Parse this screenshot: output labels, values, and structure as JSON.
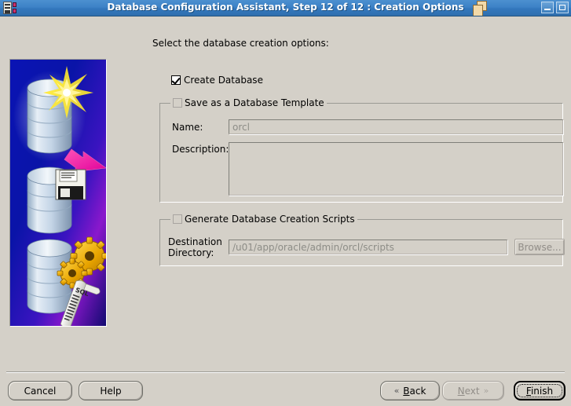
{
  "window": {
    "title": "Database Configuration Assistant, Step 12 of 12 : Creation Options",
    "icon_name": "dbca-app-icon",
    "overlay_icon_name": "copy-windows-icon",
    "minimize_label": "Minimize",
    "maximize_label": "Maximize"
  },
  "page": {
    "instruction": "Select the database creation options:"
  },
  "create_database": {
    "label": "Create Database",
    "checked": true
  },
  "template_group": {
    "title": "Save as a Database Template",
    "checked": false,
    "name_label": "Name:",
    "name_value": "orcl",
    "description_label": "Description:",
    "description_value": ""
  },
  "scripts_group": {
    "title": "Generate Database Creation Scripts",
    "checked": false,
    "destination_label_line1": "Destination",
    "destination_label_line2": "Directory:",
    "destination_value": "/u01/app/oracle/admin/orcl/scripts",
    "browse_label": "Browse...",
    "browse_enabled": false
  },
  "footer": {
    "cancel_label": "Cancel",
    "help_label": "Help",
    "back_label_pre": "",
    "back_label_mn": "B",
    "back_label_post": "ack",
    "next_label_mn": "N",
    "next_label_post": "ext",
    "finish_label_mn": "F",
    "finish_label_post": "inish",
    "back_arrow": "«",
    "next_arrow": "»",
    "next_enabled": false,
    "finish_focused": true
  },
  "artwork": {
    "name": "database-creation-illustration",
    "alt": "Three blue database cylinders on a blue-to-purple gradient: top cylinder with a yellow star and magenta arrow, middle cylinder with a floppy disk, bottom cylinder with gold gears and a SQL script scroll",
    "colors": {
      "bg_top": "#0a14b4",
      "bg_purple": "#7a19c8",
      "cylinder": "#cddcea",
      "star": "#ffe02a",
      "arrow": "#ff2aa0",
      "gear": "#f0b400"
    }
  }
}
